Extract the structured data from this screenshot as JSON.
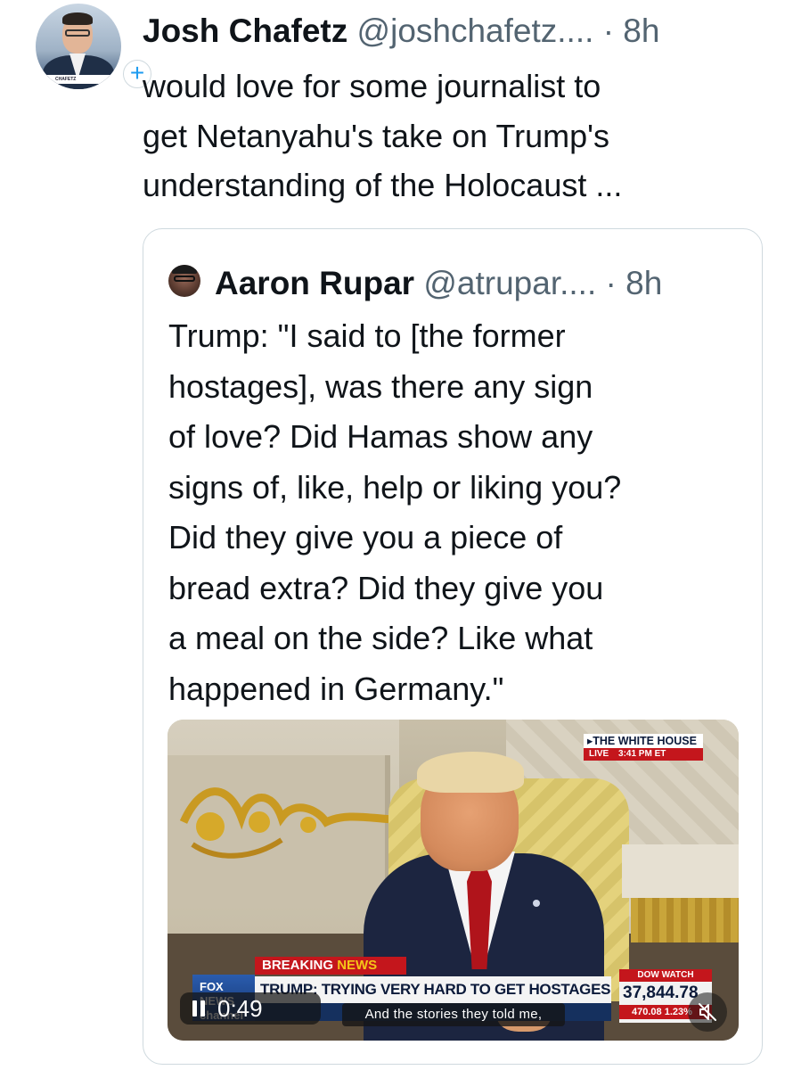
{
  "tweet": {
    "author": {
      "name": "Josh Chafetz",
      "handle": "@joshchafetz....",
      "separator": "·",
      "time": "8h",
      "follow_symbol": "+"
    },
    "text_lines": [
      "would love for some journalist to",
      "get Netanyahu's take on Trump's",
      "understanding of the Holocaust ..."
    ]
  },
  "quote": {
    "author": {
      "name": "Aaron Rupar",
      "handle": "@atrupar....",
      "separator": "·",
      "time": "8h"
    },
    "text_lines": [
      "Trump: \"I said to [the former",
      "hostages], was there any sign",
      "of love? Did Hamas show any",
      "signs of, like, help or liking you?",
      "Did they give you a piece of",
      "bread extra? Did they give you",
      "a meal on the side? Like what",
      "happened in Germany.\""
    ],
    "video": {
      "overlay": {
        "location_tag": "▸THE WHITE HOUSE",
        "live_label": "LIVE",
        "live_time": "3:41 PM ET",
        "breaking_label": "BREAKING",
        "breaking_news": "NEWS",
        "network_logo": "FOX NEWS channel",
        "headline": "TRUMP: TRYING VERY HARD TO GET HOSTAGES OUT",
        "ticker_title": "DOW WATCH",
        "ticker_value": "37,844.78",
        "ticker_change": "470.08 1.23%"
      },
      "timecode": "0:49",
      "caption": "And the stories they told me,"
    }
  },
  "colors": {
    "text_primary": "#0f1419",
    "text_secondary": "#536471",
    "border": "#cfd9de",
    "accent": "#1d9bf0",
    "fox_red": "#c4161c"
  },
  "icons": [
    "pause-icon",
    "mute-icon",
    "follow-plus-icon"
  ]
}
